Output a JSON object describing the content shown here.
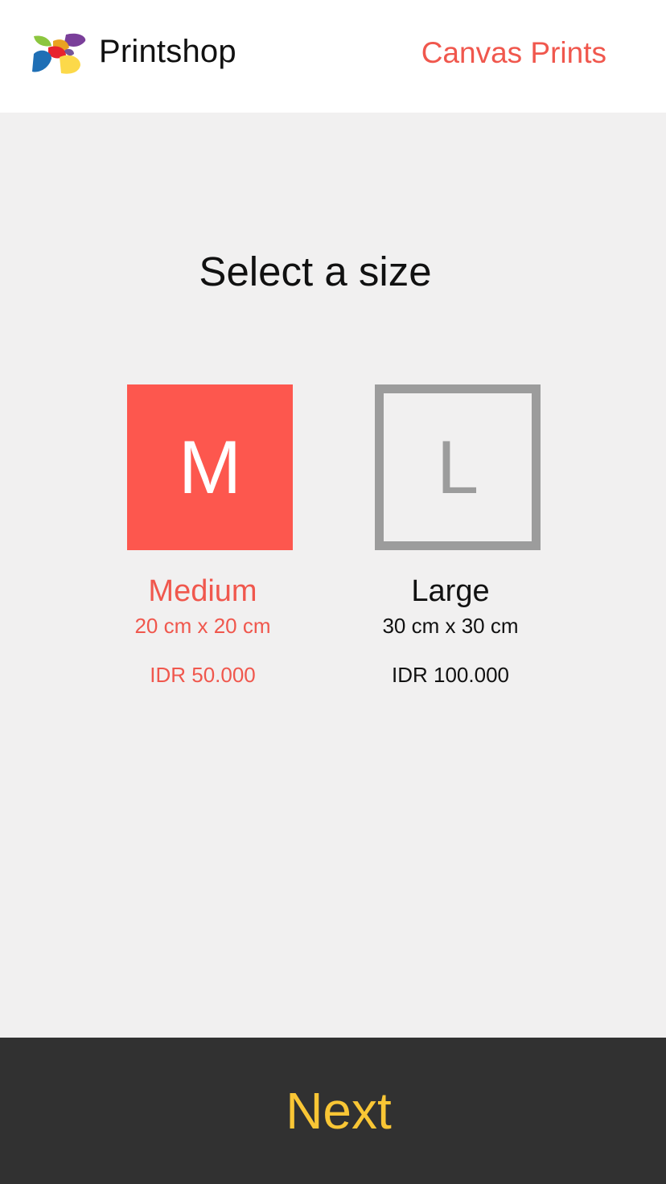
{
  "header": {
    "brand": "Printshop",
    "product": "Canvas Prints",
    "logo_icon": "printshop-petal-logo"
  },
  "page": {
    "title": "Select a size"
  },
  "sizes": [
    {
      "letter": "M",
      "name": "Medium",
      "dimensions": "20 cm x 20 cm",
      "price": "IDR 50.000",
      "selected": true
    },
    {
      "letter": "L",
      "name": "Large",
      "dimensions": "30 cm x 30 cm",
      "price": "IDR 100.000",
      "selected": false
    }
  ],
  "footer": {
    "next_label": "Next"
  },
  "colors": {
    "accent_red": "#fd574e",
    "text_red": "#f0574d",
    "next_yellow": "#f9c635",
    "footer_bg": "#313131",
    "background": "#f1f0f0",
    "unselected_gray": "#9c9c9c"
  }
}
